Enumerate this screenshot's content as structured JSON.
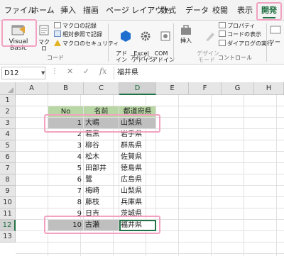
{
  "ribbon_tabs": [
    "ファイル",
    "ホーム",
    "挿入",
    "描画",
    "ページ レイアウト",
    "数式",
    "データ",
    "校閲",
    "表示",
    "開発"
  ],
  "ribbon": {
    "visual_basic": "Visual Basic",
    "macro": "マクロ",
    "record_macro": "マクロの記録",
    "relative_ref": "相対参照で記録",
    "macro_security": "マクロのセキュリティ",
    "code_group": "コード",
    "addin": "アド\nイン",
    "excel_addin": "Excel\nアドイン",
    "com_addin": "COM\nアドイン",
    "addin_group": "アドイン",
    "insert": "挿入",
    "design_mode": "デザイン\nモード",
    "properties": "プロパティ",
    "view_code": "コードの表示",
    "run_dialog": "ダイアログの実行",
    "controls_group": "コントロール",
    "source_partial": "ソー"
  },
  "formula_bar": {
    "name_box": "D12",
    "formula": "福井県",
    "fx": "fx"
  },
  "columns": [
    "A",
    "B",
    "C",
    "D",
    "E",
    "F",
    "G",
    "H"
  ],
  "rows": [
    "1",
    "2",
    "3",
    "4",
    "5",
    "6",
    "7",
    "8",
    "9",
    "10",
    "11",
    "12",
    "13"
  ],
  "table": {
    "headers": [
      "No",
      "名前",
      "都道府県"
    ],
    "rows": [
      [
        "1",
        "大嶋",
        "山梨県"
      ],
      [
        "2",
        "若黒",
        "岩手県"
      ],
      [
        "3",
        "柳谷",
        "群馬県"
      ],
      [
        "4",
        "松木",
        "佐賀県"
      ],
      [
        "5",
        "田部井",
        "徳島県"
      ],
      [
        "6",
        "鷺",
        "広島県"
      ],
      [
        "7",
        "梅崎",
        "山梨県"
      ],
      [
        "8",
        "藤枝",
        "兵庫県"
      ],
      [
        "9",
        "日吉",
        "茨城県"
      ],
      [
        "10",
        "古瀬",
        "福井県"
      ]
    ]
  },
  "colors": {
    "accent": "#217346",
    "header_fill": "#b9d7a4",
    "gray_fill": "#bfbfbf",
    "highlight": "#f2a2c0"
  }
}
